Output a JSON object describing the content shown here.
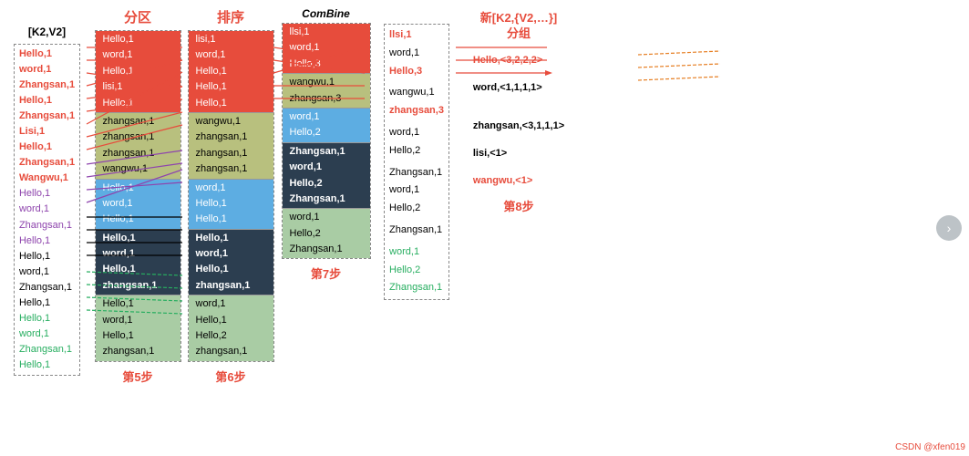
{
  "header": {
    "k2v2_title": "[K2,V2]",
    "partition_title": "分区",
    "sort_title": "排序",
    "combine_title": "ComBine",
    "newgroup_title": "新[K2,{V2,…}]",
    "newgroup_subtitle": "分组"
  },
  "steps": {
    "step5": "第5步",
    "step6": "第6步",
    "step7": "第7步",
    "step8": "第8步"
  },
  "left_items": [
    {
      "text": "[K2,V2]",
      "class": "black title"
    },
    {
      "text": "Hello,1",
      "class": "red"
    },
    {
      "text": "word,1",
      "class": "red"
    },
    {
      "text": "Zhangsan,1",
      "class": "red"
    },
    {
      "text": "Hello,1",
      "class": "red"
    },
    {
      "text": "Zhangsan,1",
      "class": "red"
    },
    {
      "text": "Lisi,1",
      "class": "red"
    },
    {
      "text": "Hello,1",
      "class": "red"
    },
    {
      "text": "Zhangsan,1",
      "class": "red"
    },
    {
      "text": "Wangwu,1",
      "class": "red"
    },
    {
      "text": "Hello,1",
      "class": "purple"
    },
    {
      "text": "word,1",
      "class": "purple"
    },
    {
      "text": "Zhangsan,1",
      "class": "purple"
    },
    {
      "text": "Hello,1",
      "class": "purple"
    },
    {
      "text": "Hello,1",
      "class": "black"
    },
    {
      "text": "word,1",
      "class": "black"
    },
    {
      "text": "Zhangsan,1",
      "class": "black"
    },
    {
      "text": "Hello,1",
      "class": "black"
    },
    {
      "text": "Hello,1",
      "class": "green"
    },
    {
      "text": "word,1",
      "class": "green"
    },
    {
      "text": "Zhangsan,1",
      "class": "green"
    },
    {
      "text": "Hello,1",
      "class": "green"
    }
  ],
  "partition_red": [
    "Hello,1",
    "word,1",
    "Hello,1",
    "lisi,1",
    "Hello,1"
  ],
  "partition_olive": [
    "zhangsan,1",
    "zhangsan,1",
    "zhangsan,1",
    "wangwu,1"
  ],
  "partition_blue": [
    "Hello,1",
    "word,1",
    "Hello,1"
  ],
  "partition_black": [
    "Hello,1",
    "word,1",
    "Hello,1",
    "zhangsan,1"
  ],
  "partition_green": [
    "Hello,1",
    "word,1",
    "Hello,1",
    "zhangsan,1"
  ],
  "sort_red": [
    "lisi,1",
    "word,1",
    "Hello,1",
    "Hello,1",
    "Hello,1"
  ],
  "sort_olive": [
    "wangwu,1",
    "zhangsan,1",
    "zhangsan,1",
    "zhangsan,1"
  ],
  "sort_blue": [
    "word,1",
    "Hello,1",
    "Hello,1"
  ],
  "sort_black": [
    "Hello,1",
    "word,1",
    "Hello,1",
    "zhangsan,1"
  ],
  "sort_green": [
    "word,1",
    "Hello,1",
    "Hello,2",
    "zhangsan,1"
  ],
  "combine_red": [
    "llsi,1",
    "word,1",
    "Hello,3"
  ],
  "combine_olive": [
    "wangwu,1",
    "zhangsan,3"
  ],
  "combine_blue": [
    "word,1",
    "Hello,2"
  ],
  "combine_black": [
    "Zhangsan,1",
    "word,1",
    "Hello,2",
    "Zhangsan,1"
  ],
  "combine_green": [
    "word,1",
    "Hello,2",
    "Zhangsan,1"
  ],
  "right_items": [
    {
      "text": "Hello,<3,2,2,2>",
      "class": "red"
    },
    {
      "text": "word,<1,1,1,1>",
      "class": "black"
    },
    {
      "text": "zhangsan,<3,1,1,1>",
      "class": "black"
    },
    {
      "text": "lisi,<1>",
      "class": "black"
    },
    {
      "text": "wangwu,<1>",
      "class": "red"
    }
  ],
  "nav": {
    "arrow": "›"
  },
  "watermark": "CSDN @xfen019"
}
